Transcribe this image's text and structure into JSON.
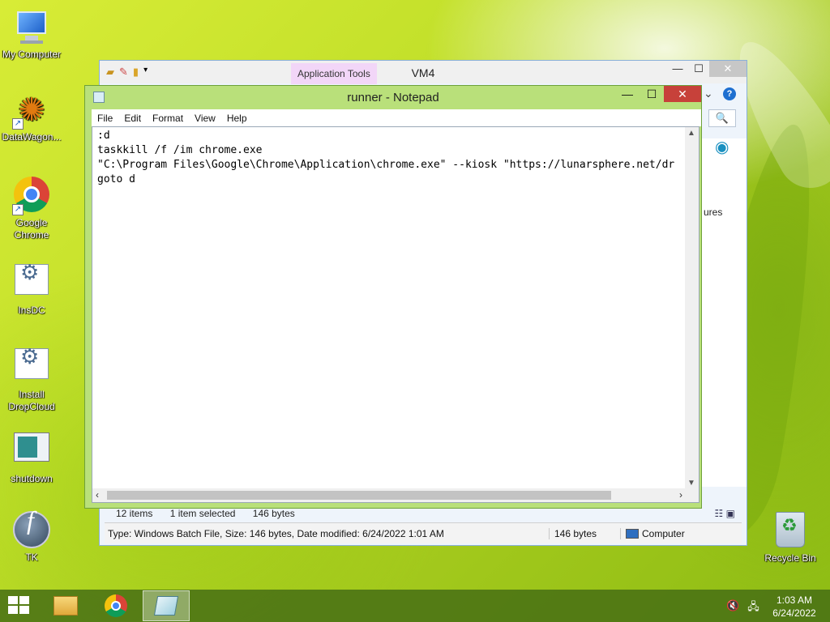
{
  "desktop": {
    "icons": [
      {
        "label": "My Computer"
      },
      {
        "label": "DataWagon..."
      },
      {
        "label": "Google Chrome"
      },
      {
        "label": "InsDC"
      },
      {
        "label": "Install DropCloud"
      },
      {
        "label": "shutdown"
      },
      {
        "label": "TK"
      },
      {
        "label": "Recycle Bin"
      }
    ]
  },
  "explorer": {
    "contextual_tab": "Application Tools",
    "title": "VM4",
    "controls": {
      "minimize": "—",
      "maximize": "☐",
      "close": "✕"
    },
    "chevron": "⌄",
    "help": "?",
    "search_icon": "🔍",
    "partial_item_label": "ures",
    "status": {
      "items": "12 items",
      "selected": "1 item selected",
      "size": "146 bytes"
    },
    "details": {
      "info": "Type: Windows Batch File, Size: 146 bytes, Date modified: 6/24/2022 1:01 AM",
      "size": "146 bytes",
      "location": "Computer"
    }
  },
  "notepad": {
    "title": "runner - Notepad",
    "controls": {
      "minimize": "—",
      "maximize": "☐",
      "close": "✕"
    },
    "menu": [
      "File",
      "Edit",
      "Format",
      "View",
      "Help"
    ],
    "content": ":d\ntaskkill /f /im chrome.exe\n\"C:\\Program Files\\Google\\Chrome\\Application\\chrome.exe\" --kiosk \"https://lunarsphere.net/dr\ngoto d"
  },
  "taskbar": {
    "apps": [
      "file-explorer",
      "google-chrome",
      "notepad"
    ],
    "tray": {
      "volume": "🔇",
      "network": "🖧"
    },
    "clock": {
      "time": "1:03 AM",
      "date": "6/24/2022"
    }
  }
}
